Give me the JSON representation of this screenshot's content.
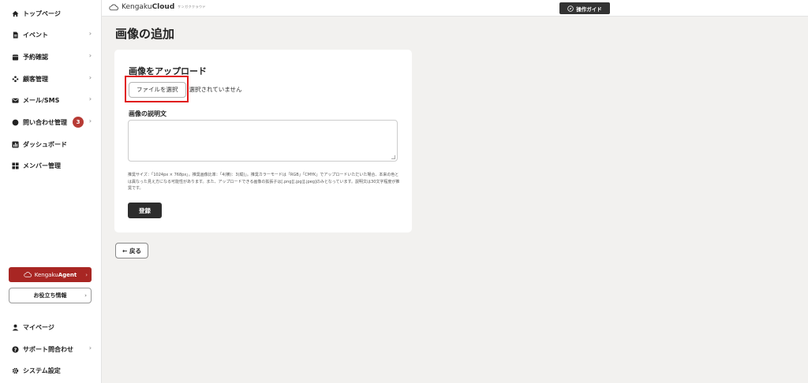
{
  "sidebar": {
    "items": [
      {
        "label": "トップページ",
        "icon": "home-icon",
        "chevron": false
      },
      {
        "label": "イベント",
        "icon": "document-icon",
        "chevron": true
      },
      {
        "label": "予約確認",
        "icon": "calendar-icon",
        "chevron": true
      },
      {
        "label": "顧客管理",
        "icon": "people-icon",
        "chevron": true
      },
      {
        "label": "メール/SMS",
        "icon": "mail-icon",
        "chevron": true
      },
      {
        "label": "問い合わせ管理",
        "icon": "chat-icon",
        "chevron": true,
        "badge": "3"
      },
      {
        "label": "ダッシュボード",
        "icon": "chart-icon",
        "chevron": false
      },
      {
        "label": "メンバー管理",
        "icon": "grid-icon",
        "chevron": false
      }
    ],
    "agent_prefix": "Kengaku",
    "agent_suffix": "Agent",
    "info_label": "お役立ち情報",
    "bottom_items": [
      {
        "label": "マイページ",
        "icon": "user-icon",
        "chevron": false
      },
      {
        "label": "サポート問合わせ",
        "icon": "help-icon",
        "chevron": true
      },
      {
        "label": "システム設定",
        "icon": "gear-icon",
        "chevron": false
      }
    ]
  },
  "header": {
    "logo_prefix": "Kengaku",
    "logo_suffix": "Cloud",
    "logo_sub": "ケンガククラウド",
    "guide_label": "操作ガイド"
  },
  "main": {
    "page_title": "画像の追加",
    "upload_heading": "画像をアップロード",
    "file_button": "ファイルを選択",
    "no_file_text": "選択されていません",
    "desc_label": "画像の説明文",
    "desc_value": "",
    "note": "推奨サイズ：「1024px × 768px」。推奨画像比率：「4(横)：3(縦)」。推奨カラーモードは「RGB」「CMYK」でアップロードいただいた場合、本来の色とは異なった見え方になる可能性があります。また、アップロードできる画像の拡張子は[.png][.jpg][.jpeg]のみとなっています。説明文は30文字程度が推奨です。",
    "register_label": "登録",
    "back_label": "← 戻る"
  },
  "colors": {
    "accent": "#a82623",
    "badge": "#b73b35",
    "highlight": "#e01818",
    "dark_button": "#2d2d2d"
  }
}
